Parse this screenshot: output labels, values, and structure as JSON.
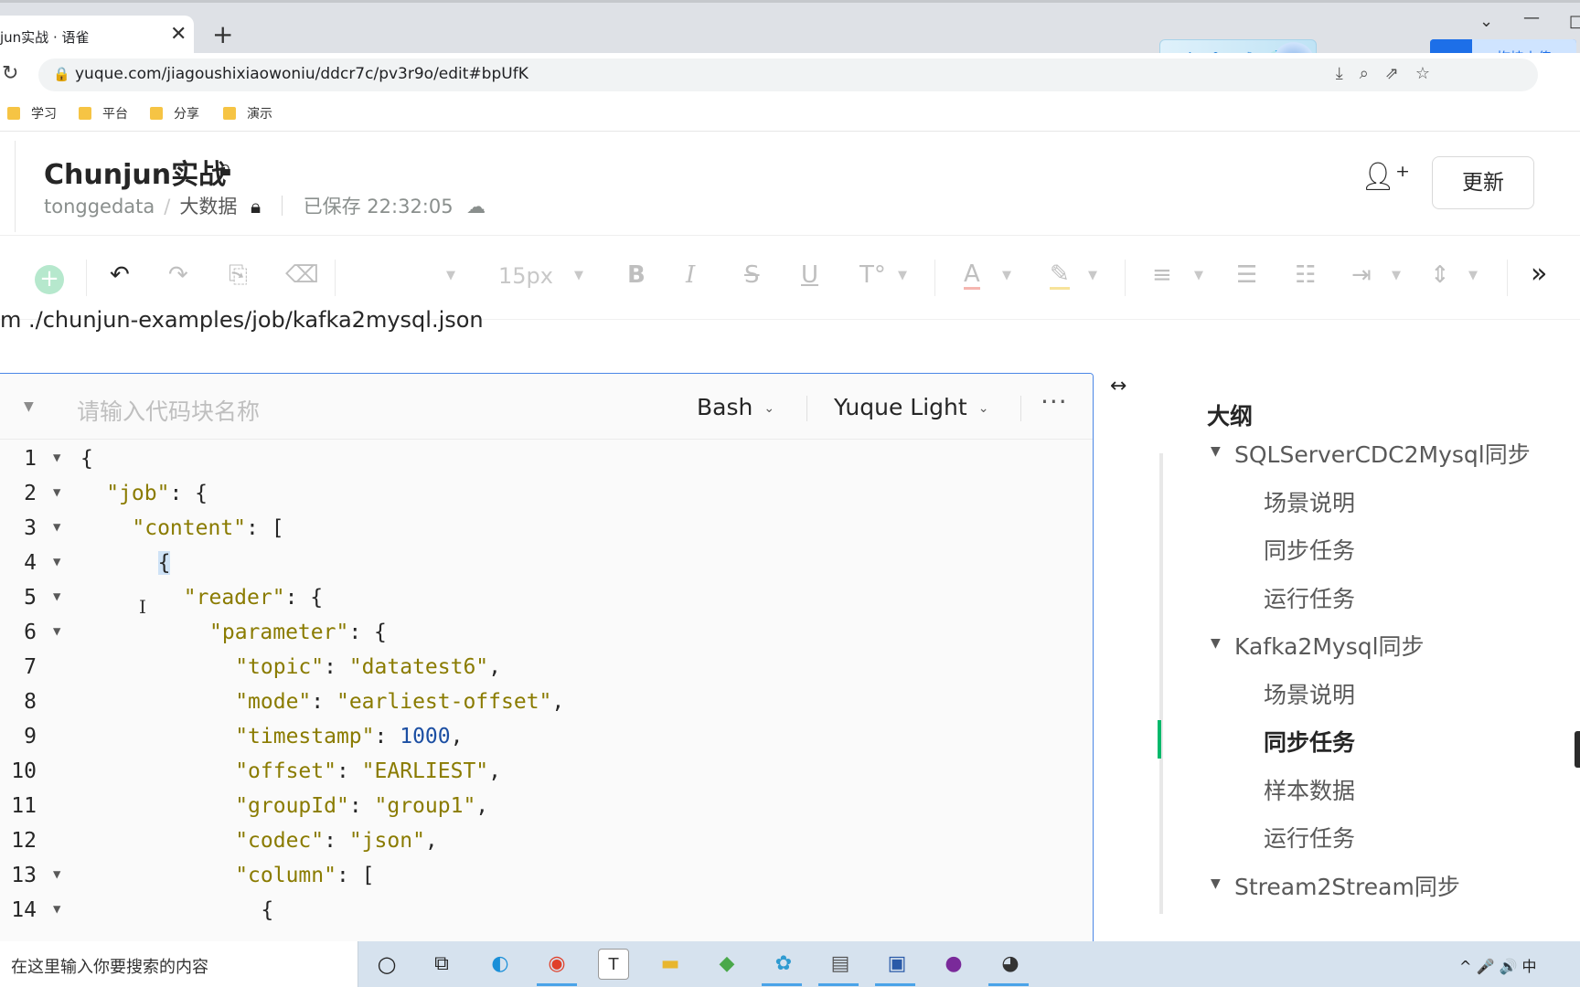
{
  "browser": {
    "tab_title": "jun实战 · 语雀",
    "tab_close": "✕",
    "new_tab": "+",
    "url": "yuque.com/jiagoushixiaowoniu/ddcr7c/pv3r9o/edit#bpUfK",
    "bookmarks": [
      "学习",
      "平台",
      "分享",
      "演示"
    ],
    "ime_label": "中",
    "ime_icons": "°, ☽ 👕",
    "baidu_upload": "拖拽上传"
  },
  "doc": {
    "title": "Chunjun实战",
    "crumb_team": "tonggedata",
    "crumb_sep": "/",
    "crumb_book": "大数据",
    "saved_status": "已保存 22:32:05",
    "update_button": "更新"
  },
  "toolbar": {
    "font_size": "15px"
  },
  "editor": {
    "previous_line": "m ./chunjun-examples/job/kafka2mysql.json",
    "code_block": {
      "name_placeholder": "请输入代码块名称",
      "language": "Bash",
      "theme": "Yuque Light",
      "more": "···"
    },
    "lines": [
      {
        "n": "1",
        "fold": true,
        "indent": 0,
        "tokens": [
          {
            "t": "{",
            "c": "pun"
          }
        ]
      },
      {
        "n": "2",
        "fold": true,
        "indent": 1,
        "tokens": [
          {
            "t": "\"job\"",
            "c": "key"
          },
          {
            "t": ": {",
            "c": "pun"
          }
        ]
      },
      {
        "n": "3",
        "fold": true,
        "indent": 2,
        "tokens": [
          {
            "t": "\"content\"",
            "c": "key"
          },
          {
            "t": ": [",
            "c": "pun"
          }
        ]
      },
      {
        "n": "4",
        "fold": true,
        "indent": 3,
        "tokens": [
          {
            "t": "{",
            "c": "pun cur-hl"
          }
        ]
      },
      {
        "n": "5",
        "fold": true,
        "indent": 4,
        "tokens": [
          {
            "t": "\"reader\"",
            "c": "key"
          },
          {
            "t": ": {",
            "c": "pun"
          }
        ]
      },
      {
        "n": "6",
        "fold": true,
        "indent": 5,
        "tokens": [
          {
            "t": "\"parameter\"",
            "c": "key"
          },
          {
            "t": ": {",
            "c": "pun"
          }
        ]
      },
      {
        "n": "7",
        "fold": false,
        "indent": 6,
        "tokens": [
          {
            "t": "\"topic\"",
            "c": "key"
          },
          {
            "t": ": ",
            "c": "pun"
          },
          {
            "t": "\"datatest6\"",
            "c": "str"
          },
          {
            "t": ",",
            "c": "pun"
          }
        ]
      },
      {
        "n": "8",
        "fold": false,
        "indent": 6,
        "tokens": [
          {
            "t": "\"mode\"",
            "c": "key"
          },
          {
            "t": ": ",
            "c": "pun"
          },
          {
            "t": "\"earliest-offset\"",
            "c": "str"
          },
          {
            "t": ",",
            "c": "pun"
          }
        ]
      },
      {
        "n": "9",
        "fold": false,
        "indent": 6,
        "tokens": [
          {
            "t": "\"timestamp\"",
            "c": "key"
          },
          {
            "t": ": ",
            "c": "pun"
          },
          {
            "t": "1000",
            "c": "num"
          },
          {
            "t": ",",
            "c": "pun"
          }
        ]
      },
      {
        "n": "10",
        "fold": false,
        "indent": 6,
        "tokens": [
          {
            "t": "\"offset\"",
            "c": "key"
          },
          {
            "t": ": ",
            "c": "pun"
          },
          {
            "t": "\"EARLIEST\"",
            "c": "str"
          },
          {
            "t": ",",
            "c": "pun"
          }
        ]
      },
      {
        "n": "11",
        "fold": false,
        "indent": 6,
        "tokens": [
          {
            "t": "\"groupId\"",
            "c": "key"
          },
          {
            "t": ": ",
            "c": "pun"
          },
          {
            "t": "\"group1\"",
            "c": "str"
          },
          {
            "t": ",",
            "c": "pun"
          }
        ]
      },
      {
        "n": "12",
        "fold": false,
        "indent": 6,
        "tokens": [
          {
            "t": "\"codec\"",
            "c": "key"
          },
          {
            "t": ": ",
            "c": "pun"
          },
          {
            "t": "\"json\"",
            "c": "str"
          },
          {
            "t": ",",
            "c": "pun"
          }
        ]
      },
      {
        "n": "13",
        "fold": true,
        "indent": 6,
        "tokens": [
          {
            "t": "\"column\"",
            "c": "key"
          },
          {
            "t": ": [",
            "c": "pun"
          }
        ]
      },
      {
        "n": "14",
        "fold": true,
        "indent": 7,
        "tokens": [
          {
            "t": "{",
            "c": "pun"
          }
        ]
      }
    ]
  },
  "outline": {
    "title": "大纲",
    "items": [
      {
        "label": "SQLServerCDC2Mysql同步",
        "level": 1,
        "caret": true,
        "active": false
      },
      {
        "label": "场景说明",
        "level": 2,
        "caret": false,
        "active": false
      },
      {
        "label": "同步任务",
        "level": 2,
        "caret": false,
        "active": false
      },
      {
        "label": "运行任务",
        "level": 2,
        "caret": false,
        "active": false
      },
      {
        "label": "Kafka2Mysql同步",
        "level": 1,
        "caret": true,
        "active": false
      },
      {
        "label": "场景说明",
        "level": 2,
        "caret": false,
        "active": false
      },
      {
        "label": "同步任务",
        "level": 2,
        "caret": false,
        "active": true
      },
      {
        "label": "样本数据",
        "level": 2,
        "caret": false,
        "active": false
      },
      {
        "label": "运行任务",
        "level": 2,
        "caret": false,
        "active": false
      },
      {
        "label": "Stream2Stream同步",
        "level": 1,
        "caret": true,
        "active": false
      }
    ]
  },
  "taskbar": {
    "search_placeholder": "在这里输入你要搜索的内容",
    "tray": "^ 🎤 🔊 中"
  },
  "colors": {
    "accent_blue": "#4b87e6",
    "active_green": "#00b96b",
    "string_olive": "#8a7b00",
    "number_blue": "#1c4fa3"
  }
}
